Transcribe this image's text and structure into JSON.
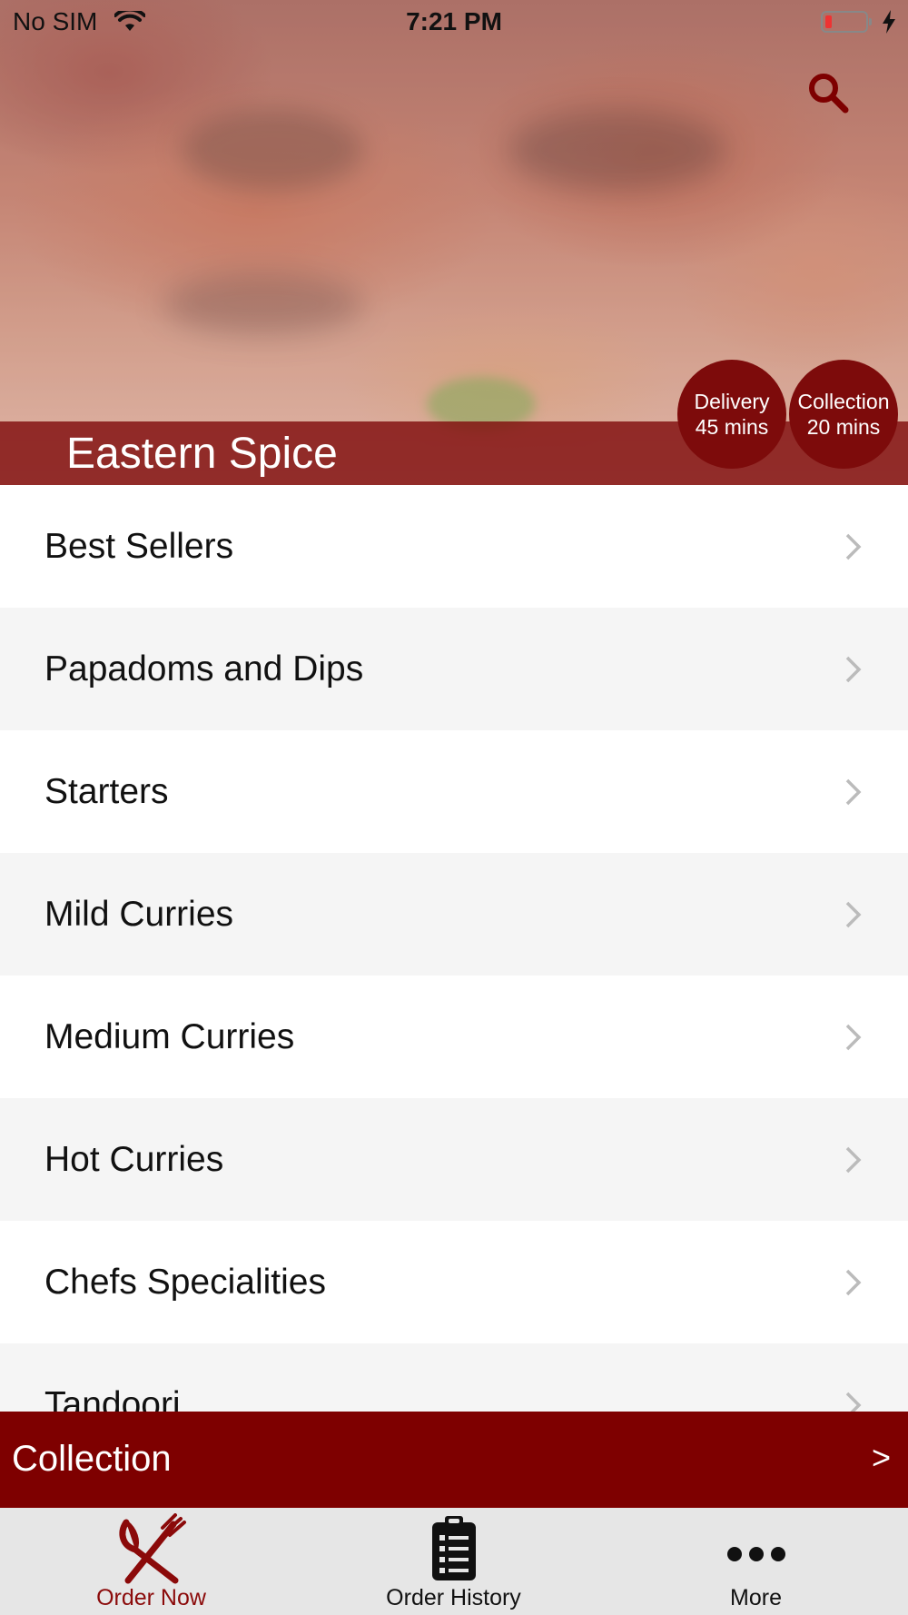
{
  "status_bar": {
    "carrier": "No SIM",
    "time": "7:21 PM"
  },
  "header": {
    "restaurant_name": "Eastern Spice",
    "delivery": {
      "label": "Delivery",
      "time": "45 mins"
    },
    "collection": {
      "label": "Collection",
      "time": "20 mins"
    }
  },
  "menu": {
    "items": [
      {
        "label": "Best Sellers"
      },
      {
        "label": "Papadoms and Dips"
      },
      {
        "label": "Starters"
      },
      {
        "label": "Mild Curries"
      },
      {
        "label": "Medium Curries"
      },
      {
        "label": "Hot Curries"
      },
      {
        "label": "Chefs Specialities"
      },
      {
        "label": "Tandoori"
      }
    ]
  },
  "order_mode_bar": {
    "label": "Collection",
    "arrow": ">"
  },
  "tabbar": {
    "tabs": [
      {
        "label": "Order Now",
        "icon": "fork-knife-icon",
        "active": true
      },
      {
        "label": "Order History",
        "icon": "clipboard-list-icon",
        "active": false
      },
      {
        "label": "More",
        "icon": "more-dots-icon",
        "active": false
      }
    ]
  },
  "colors": {
    "brand": "#7e0000",
    "active_tab": "#8b0a0a",
    "row_alt": "#f5f5f5"
  }
}
